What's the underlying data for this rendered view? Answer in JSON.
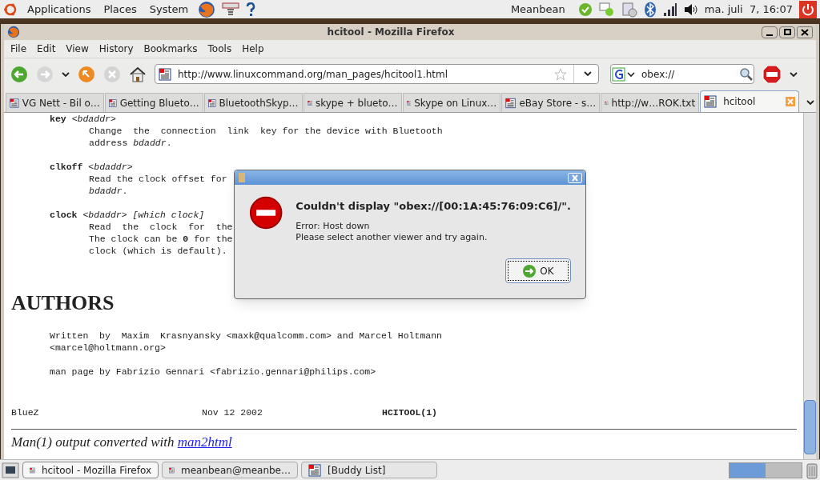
{
  "top_panel": {
    "menus": [
      "Applications",
      "Places",
      "System"
    ],
    "user": "Meanbean",
    "clock": "ma. juli  7, 16:07"
  },
  "window": {
    "title": "hcitool - Mozilla Firefox"
  },
  "menu_bar": [
    "File",
    "Edit",
    "View",
    "History",
    "Bookmarks",
    "Tools",
    "Help"
  ],
  "toolbar": {
    "url": "http://www.linuxcommand.org/man_pages/hcitool1.html",
    "search": "obex://"
  },
  "tabs": [
    {
      "label": "VG Nett - Bil o…",
      "selected": false
    },
    {
      "label": "Getting Blueto…",
      "selected": false
    },
    {
      "label": "BluetoothSkyp…",
      "selected": false
    },
    {
      "label": "skype + blueto…",
      "selected": false
    },
    {
      "label": "Skype on Linux…",
      "selected": false
    },
    {
      "label": "eBay Store - s…",
      "selected": false
    },
    {
      "label": "http://w…ROK.txt",
      "selected": false
    },
    {
      "label": "hcitool",
      "selected": true
    }
  ],
  "man_entries": [
    {
      "command": "key",
      "args": "<bdaddr>",
      "lines": [
        "Change  the  connection  link  key for the device with Bluetooth",
        "address *bdaddr*."
      ]
    },
    {
      "command": "clkoff",
      "args": "<bdaddr>",
      "lines": [
        "Read the clock offset for",
        "*bdaddr*."
      ]
    },
    {
      "command": "clock",
      "args": "<bdaddr> [which clock]",
      "lines": [
        "Read  the  clock  for  the",
        "The clock can be **0** for the",
        "clock (which is default)."
      ]
    }
  ],
  "authors": {
    "heading": "AUTHORS",
    "paragraphs": [
      [
        "Written  by  Maxim  Krasnyansky <maxk@qualcomm.com> and Marcel Holtmann",
        "<marcel@holtmann.org>"
      ],
      [
        "man page by Fabrizio Gennari <fabrizio.gennari@philips.com>"
      ]
    ]
  },
  "footer": {
    "left": "BlueZ",
    "center": "Nov 12 2002",
    "right": "HCITOOL(1)",
    "note": "Man(1) output converted with",
    "link": "man2html"
  },
  "dialog": {
    "heading": "Couldn't display \"obex://[00:1A:45:76:09:C6]/\".",
    "lines": [
      "Error: Host down",
      "Please select another viewer and try again."
    ],
    "button": "OK"
  },
  "taskbar": [
    {
      "label": "hcitool - Mozilla Firefox",
      "selected": true
    },
    {
      "label": "meanbean@meanbe…",
      "selected": false
    },
    {
      "label": "[Buddy List]",
      "selected": false
    }
  ]
}
